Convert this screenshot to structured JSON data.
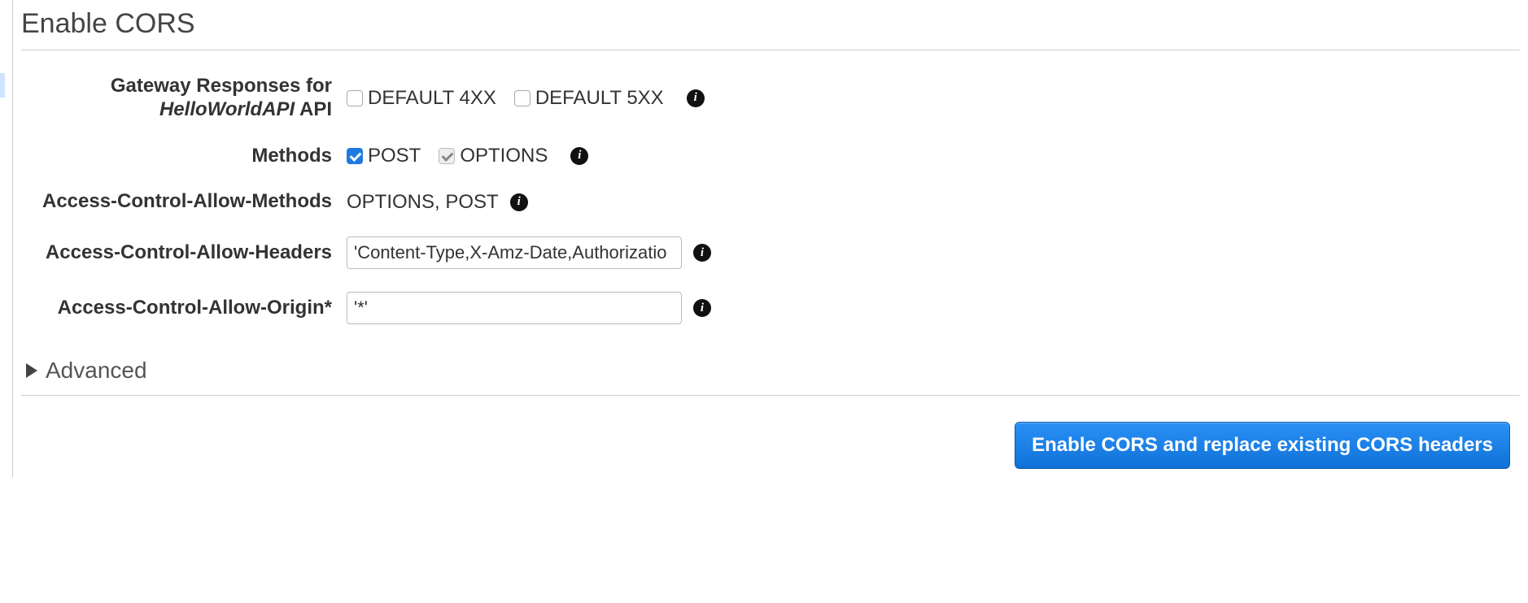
{
  "page_title": "Enable CORS",
  "gateway_responses": {
    "label_line1": "Gateway Responses for",
    "api_name": "HelloWorldAPI",
    "label_line2_suffix": " API",
    "default4xx": {
      "label": "DEFAULT 4XX",
      "checked": false
    },
    "default5xx": {
      "label": "DEFAULT 5XX",
      "checked": false
    }
  },
  "methods": {
    "label": "Methods",
    "post": {
      "label": "POST",
      "checked": true
    },
    "options": {
      "label": "OPTIONS",
      "checked": true,
      "disabled": true
    }
  },
  "allow_methods": {
    "label": "Access-Control-Allow-Methods",
    "value": "OPTIONS, POST"
  },
  "allow_headers": {
    "label": "Access-Control-Allow-Headers",
    "value": "'Content-Type,X-Amz-Date,Authorizatio"
  },
  "allow_origin": {
    "label": "Access-Control-Allow-Origin*",
    "value": "'*'"
  },
  "advanced_label": "Advanced",
  "submit_button": "Enable CORS and replace existing CORS headers",
  "info_glyph": "i"
}
